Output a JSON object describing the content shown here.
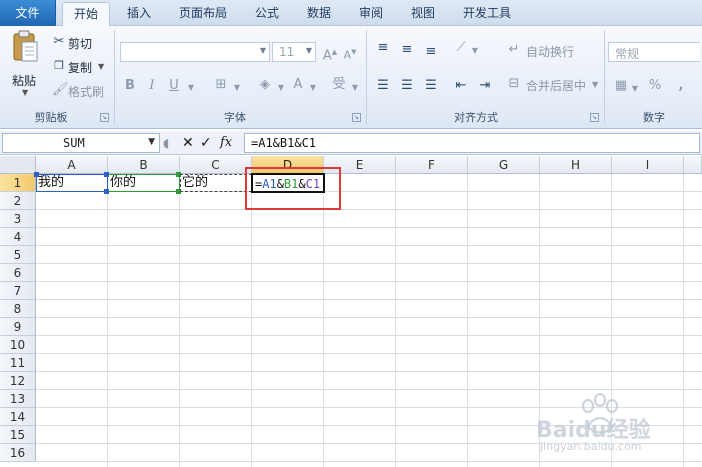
{
  "tabs": [
    "文件",
    "开始",
    "插入",
    "页面布局",
    "公式",
    "数据",
    "审阅",
    "视图",
    "开发工具"
  ],
  "clipboard": {
    "paste": "粘贴",
    "cut": "剪切",
    "copy": "复制",
    "format_painter": "格式刷",
    "label": "剪贴板"
  },
  "font": {
    "size": "11",
    "label": "字体"
  },
  "alignment": {
    "wrap": "自动换行",
    "merge": "合并后居中",
    "label": "对齐方式"
  },
  "number": {
    "format": "常规",
    "label": "数字"
  },
  "formula_bar": {
    "name_box": "SUM",
    "formula": "=A1&B1&C1"
  },
  "columns": [
    "A",
    "B",
    "C",
    "D",
    "E",
    "F",
    "G",
    "H",
    "I"
  ],
  "rows": [
    "1",
    "2",
    "3",
    "4",
    "5",
    "6",
    "7",
    "8",
    "9",
    "10",
    "11",
    "12",
    "13",
    "14",
    "15",
    "16"
  ],
  "cells": {
    "A1": "我的",
    "B1": "你的",
    "C1": "它的",
    "D1_parts": [
      "=",
      "A1",
      "&",
      "B1",
      "&",
      "C1"
    ]
  },
  "colors": {
    "ref_a": "#2e5ec9",
    "ref_b": "#2f9a3a",
    "ref_c": "#7a3fb5",
    "highlight": "#e23a3a",
    "selected_header": "#f4c86a"
  },
  "watermark": {
    "brand": "Baidu经验",
    "url": "jingyan.baidu.com"
  }
}
